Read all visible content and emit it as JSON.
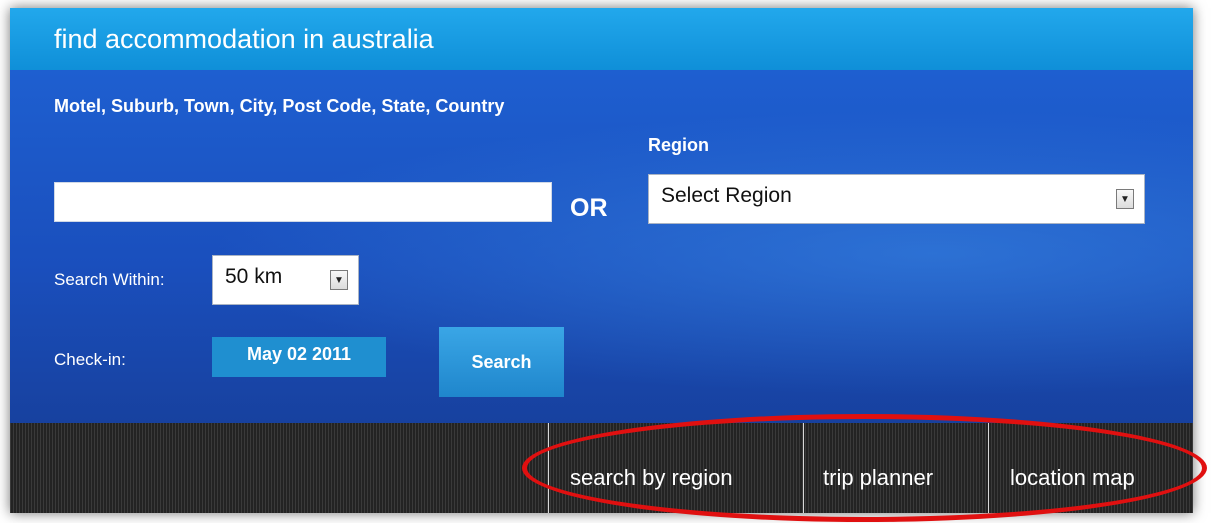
{
  "header": {
    "title": "find accommodation in australia"
  },
  "search": {
    "location_label": "Motel, Suburb, Town, City, Post Code, State, Country",
    "location_value": "",
    "or_label": "OR",
    "region_label": "Region",
    "region_selected": "Select Region",
    "within_label": "Search Within:",
    "within_selected": "50 km",
    "checkin_label": "Check-in:",
    "checkin_date": "May 02 2011",
    "search_button": "Search"
  },
  "nav": {
    "items": [
      {
        "label": "search by region"
      },
      {
        "label": "trip planner"
      },
      {
        "label": "location map"
      }
    ]
  },
  "colors": {
    "title_bar": "#1ea0e6",
    "panel": "#1a4fb8",
    "button": "#1f8fd0",
    "nav_bar": "#262626",
    "annotation": "#e01010"
  },
  "icons": {
    "dropdown": "chevron-down-icon"
  }
}
